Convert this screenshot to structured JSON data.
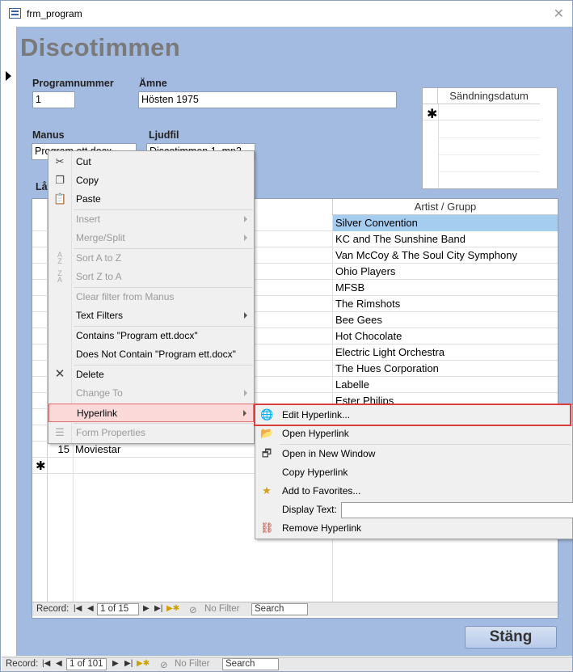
{
  "window": {
    "title": "frm_program",
    "close_glyph": "✕"
  },
  "form": {
    "title": "Discotimmen",
    "fields": {
      "programnummer": {
        "label": "Programnummer",
        "value": "1"
      },
      "amne": {
        "label": "Ämne",
        "value": "Hösten 1975"
      },
      "manus": {
        "label": "Manus",
        "value": "Program ett.docx"
      },
      "ljudfil": {
        "label": "Ljudfil",
        "value": "Discotimmen 1..mp3"
      },
      "latar_label": "Låt"
    },
    "sandning": {
      "header": "Sändningsdatum",
      "new_row": "✱"
    },
    "songs": {
      "artist_header": "Artist / Grupp",
      "artists": [
        "Silver Convention",
        "KC and The Sunshine Band",
        "Van McCoy & The Soul City Symphony",
        "Ohio Players",
        "MFSB",
        "The Rimshots",
        "Bee Gees",
        "Hot Chocolate",
        "Electric Light Orchestra",
        "The Hues Corporation",
        "Labelle",
        "Ester Philips"
      ],
      "last_row": {
        "num": "15",
        "song": "Moviestar"
      },
      "new_row": "✱"
    },
    "sub_nav": {
      "label": "Record:",
      "position": "1 of 15",
      "filter": "No Filter",
      "search": "Search"
    },
    "close_button": "Stäng"
  },
  "main_nav": {
    "label": "Record:",
    "position": "1 of 101",
    "filter": "No Filter",
    "search": "Search"
  },
  "context_menu": {
    "cut": "Cut",
    "copy": "Copy",
    "paste": "Paste",
    "insert": "Insert",
    "merge_split": "Merge/Split",
    "sort_az": "Sort A to Z",
    "sort_za": "Sort Z to A",
    "clear_filter": "Clear filter from Manus",
    "text_filters": "Text Filters",
    "contains": "Contains \"Program ett.docx\"",
    "not_contains": "Does Not Contain \"Program ett.docx\"",
    "delete": "Delete",
    "change_to": "Change To",
    "hyperlink": "Hyperlink",
    "form_properties": "Form Properties"
  },
  "hyperlink_menu": {
    "edit": "Edit Hyperlink...",
    "open": "Open Hyperlink",
    "open_new": "Open in New Window",
    "copy": "Copy Hyperlink",
    "favorites": "Add to Favorites...",
    "display_text": "Display Text:",
    "remove": "Remove Hyperlink"
  }
}
